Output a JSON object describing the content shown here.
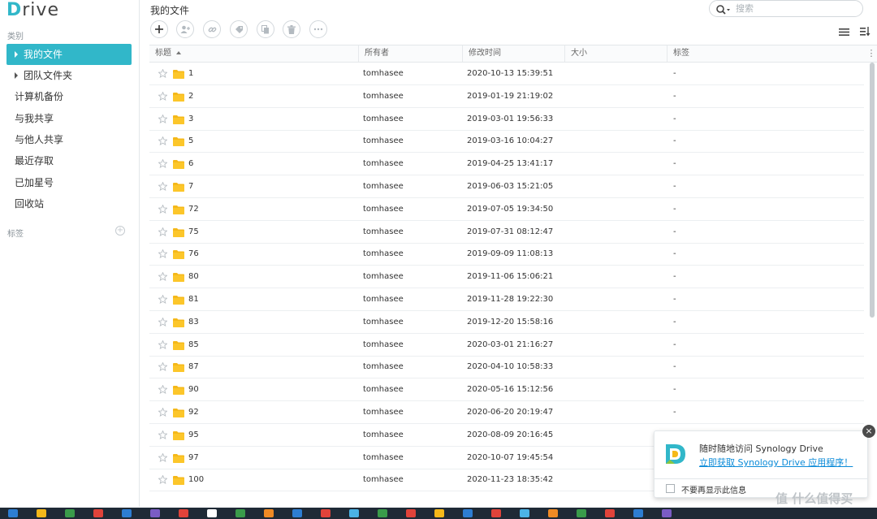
{
  "app": {
    "logo_first": "D",
    "logo_rest": "rive"
  },
  "sidebar": {
    "section_category": "类别",
    "items": [
      {
        "label": "我的文件"
      },
      {
        "label": "团队文件夹"
      },
      {
        "label": "计算机备份"
      },
      {
        "label": "与我共享"
      },
      {
        "label": "与他人共享"
      },
      {
        "label": "最近存取"
      },
      {
        "label": "已加星号"
      },
      {
        "label": "回收站"
      }
    ],
    "section_tags": "标签",
    "tag_add": "+"
  },
  "header": {
    "title": "我的文件",
    "search_placeholder": "搜索"
  },
  "table": {
    "columns": {
      "name": "标题",
      "owner": "所有者",
      "modified": "修改时间",
      "size": "大小",
      "tags": "标签"
    },
    "rows": [
      {
        "name": "1",
        "owner": "tomhasee",
        "modified": "2020-10-13 15:39:51",
        "size": "",
        "tags": "-"
      },
      {
        "name": "2",
        "owner": "tomhasee",
        "modified": "2019-01-19 21:19:02",
        "size": "",
        "tags": "-"
      },
      {
        "name": "3",
        "owner": "tomhasee",
        "modified": "2019-03-01 19:56:33",
        "size": "",
        "tags": "-"
      },
      {
        "name": "5",
        "owner": "tomhasee",
        "modified": "2019-03-16 10:04:27",
        "size": "",
        "tags": "-"
      },
      {
        "name": "6",
        "owner": "tomhasee",
        "modified": "2019-04-25 13:41:17",
        "size": "",
        "tags": "-"
      },
      {
        "name": "7",
        "owner": "tomhasee",
        "modified": "2019-06-03 15:21:05",
        "size": "",
        "tags": "-"
      },
      {
        "name": "72",
        "owner": "tomhasee",
        "modified": "2019-07-05 19:34:50",
        "size": "",
        "tags": "-"
      },
      {
        "name": "75",
        "owner": "tomhasee",
        "modified": "2019-07-31 08:12:47",
        "size": "",
        "tags": "-"
      },
      {
        "name": "76",
        "owner": "tomhasee",
        "modified": "2019-09-09 11:08:13",
        "size": "",
        "tags": "-"
      },
      {
        "name": "80",
        "owner": "tomhasee",
        "modified": "2019-11-06 15:06:21",
        "size": "",
        "tags": "-"
      },
      {
        "name": "81",
        "owner": "tomhasee",
        "modified": "2019-11-28 19:22:30",
        "size": "",
        "tags": "-"
      },
      {
        "name": "83",
        "owner": "tomhasee",
        "modified": "2019-12-20 15:58:16",
        "size": "",
        "tags": "-"
      },
      {
        "name": "85",
        "owner": "tomhasee",
        "modified": "2020-03-01 21:16:27",
        "size": "",
        "tags": "-"
      },
      {
        "name": "87",
        "owner": "tomhasee",
        "modified": "2020-04-10 10:58:33",
        "size": "",
        "tags": "-"
      },
      {
        "name": "90",
        "owner": "tomhasee",
        "modified": "2020-05-16 15:12:56",
        "size": "",
        "tags": "-"
      },
      {
        "name": "92",
        "owner": "tomhasee",
        "modified": "2020-06-20 20:19:47",
        "size": "",
        "tags": "-"
      },
      {
        "name": "95",
        "owner": "tomhasee",
        "modified": "2020-08-09 20:16:45",
        "size": "",
        "tags": ""
      },
      {
        "name": "97",
        "owner": "tomhasee",
        "modified": "2020-10-07 19:45:54",
        "size": "",
        "tags": ""
      },
      {
        "name": "100",
        "owner": "tomhasee",
        "modified": "2020-11-23 18:35:42",
        "size": "",
        "tags": ""
      }
    ]
  },
  "popup": {
    "title": "随时随地访问 Synology Drive",
    "link": "立即获取 Synology Drive 应用程序！",
    "checkbox_label": "不要再显示此信息",
    "close": "×"
  },
  "watermark": "值 什么值得买",
  "colors": {
    "accent": "#31b7c9",
    "folder": "#f5b819",
    "link": "#0b8bd8"
  }
}
